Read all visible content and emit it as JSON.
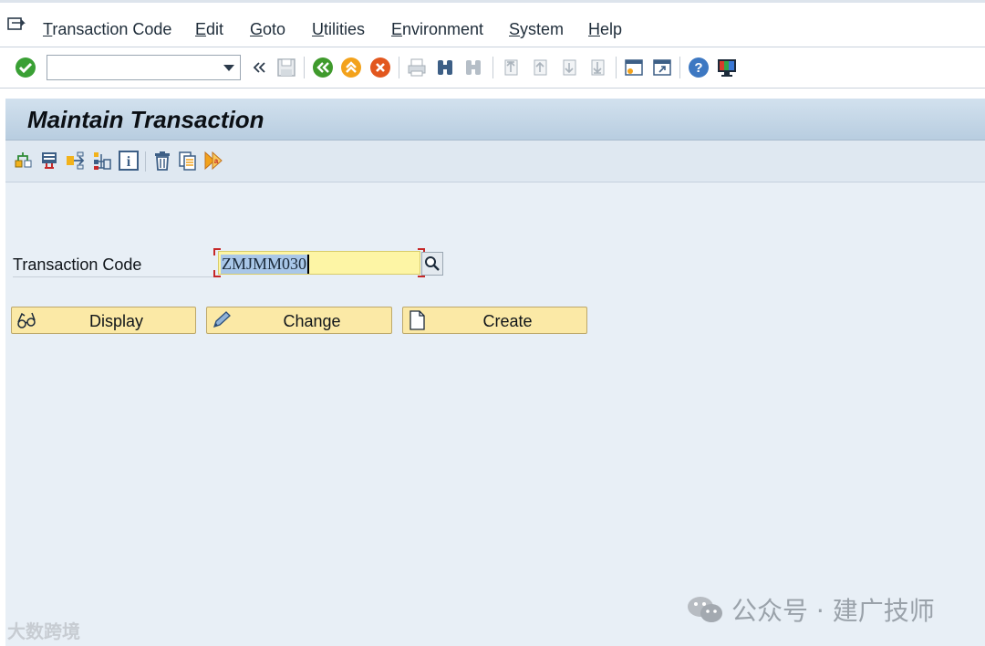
{
  "menu": {
    "items": [
      "Transaction Code",
      "Edit",
      "Goto",
      "Utilities",
      "Environment",
      "System",
      "Help"
    ]
  },
  "toolbar": {
    "command_value": "",
    "command_placeholder": "",
    "icons": [
      "enter-icon",
      "back-icon",
      "exit-icon",
      "cancel-icon",
      "print-icon",
      "find-icon",
      "find-next-icon",
      "first-page-icon",
      "previous-page-icon",
      "next-page-icon",
      "last-page-icon",
      "create-session-icon",
      "create-shortcut-icon",
      "help-icon",
      "layout-icon"
    ]
  },
  "title": "Maintain Transaction",
  "app_toolbar": {
    "icons": [
      "other-object-icon",
      "display-object-list-icon",
      "where-used-icon",
      "hierarchy-icon",
      "info-icon",
      "delete-icon",
      "copy-icon",
      "transport-icon"
    ]
  },
  "form": {
    "tcode_label": "Transaction Code",
    "tcode_value": "ZMJMM030"
  },
  "buttons": {
    "display": "Display",
    "change": "Change",
    "create": "Create"
  },
  "watermark": {
    "right": "公众号 · 建广技师",
    "left": "大数跨境"
  },
  "colors": {
    "title_bar": "#c4d6e7",
    "button_fill": "#fbe9a6",
    "input_fill": "#fdf5a5",
    "content_bg": "#e8eff6"
  }
}
